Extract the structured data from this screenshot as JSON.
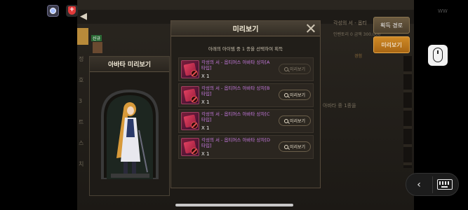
{
  "game": {
    "back_arrow": "◀",
    "equip_button": "획득 경로",
    "preview_button": "미리보기",
    "bg_right_head": "각성의 서 - 옵티",
    "bg_right_text": "인벤토리 0 금액 300,000",
    "bg_right_small": "경험",
    "bg_right_mid": "아바타 중 1종을",
    "bg_badge": "신규",
    "bg_left_labels": [
      "정",
      "호",
      "3",
      "트",
      "스",
      "치"
    ]
  },
  "avatar_panel": {
    "title": "아바타 미리보기"
  },
  "modal": {
    "title": "미리보기",
    "subtitle": "아래의 아이템 중 1 종을 선택하여 획득",
    "items": [
      {
        "name": "각성의 서 - 옵티머스 아바타 상자[A타입]",
        "qty": "X 1",
        "button": "미리보기",
        "state": "disabled"
      },
      {
        "name": "각성의 서 - 옵티머스 아바타 상자[B타입]",
        "qty": "X 1",
        "button": "미리보기",
        "state": "active"
      },
      {
        "name": "각성의 서 - 옵티머스 아바타 상자[C타입]",
        "qty": "X 1",
        "button": "미리보기",
        "state": "active"
      },
      {
        "name": "각성의 서 - 옵티머스 아바타 상자[D타입]",
        "qty": "X 1",
        "button": "미리보기",
        "state": "active"
      }
    ]
  },
  "overlay": {
    "corner_text": "WW",
    "sys_b_label": "+"
  },
  "nav": {
    "back_glyph": "‹"
  },
  "colors": {
    "item_name": "#c77ae0",
    "accent_orange": "#d08a26"
  }
}
